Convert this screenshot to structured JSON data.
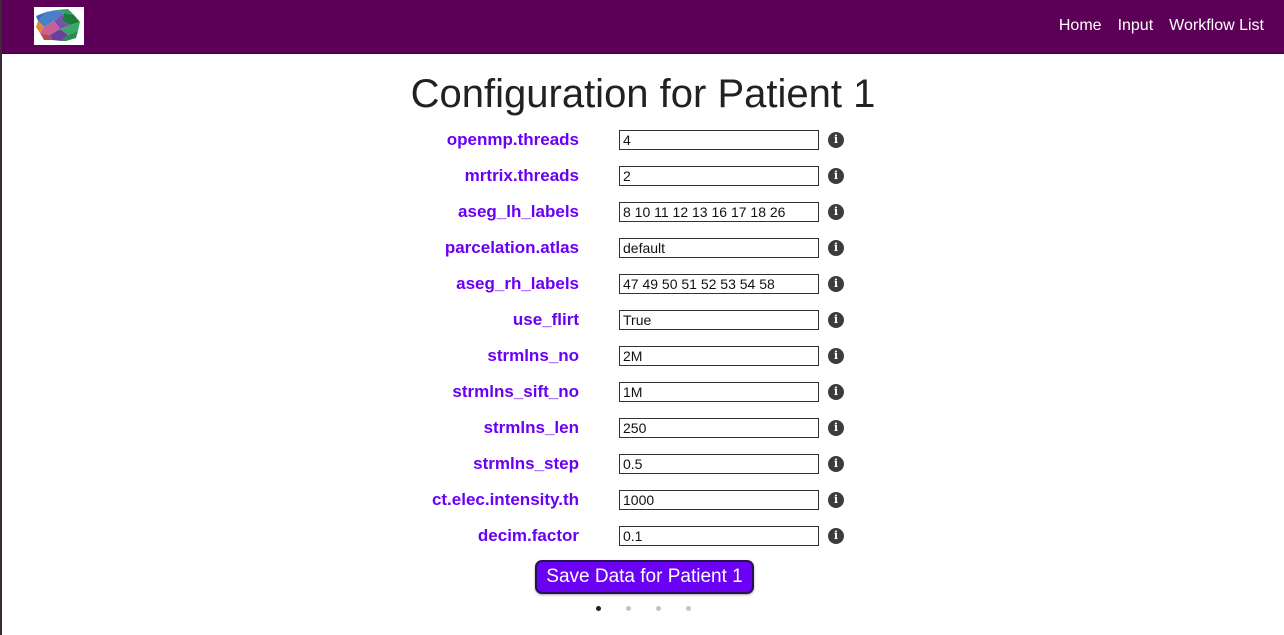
{
  "brand": {
    "logo_icon": "brain-logo-icon"
  },
  "nav": {
    "items": [
      {
        "label": "Home"
      },
      {
        "label": "Input"
      },
      {
        "label": "Workflow List"
      }
    ]
  },
  "page": {
    "title": "Configuration for Patient 1"
  },
  "config": {
    "rows": [
      {
        "label": "openmp.threads",
        "value": "4"
      },
      {
        "label": "mrtrix.threads",
        "value": "2"
      },
      {
        "label": "aseg_lh_labels",
        "value": "8 10 11 12 13 16 17 18 26"
      },
      {
        "label": "parcelation.atlas",
        "value": "default"
      },
      {
        "label": "aseg_rh_labels",
        "value": "47 49 50 51 52 53 54 58"
      },
      {
        "label": "use_flirt",
        "value": "True"
      },
      {
        "label": "strmlns_no",
        "value": "2M"
      },
      {
        "label": "strmlns_sift_no",
        "value": "1M"
      },
      {
        "label": "strmlns_len",
        "value": "250"
      },
      {
        "label": "strmlns_step",
        "value": "0.5"
      },
      {
        "label": "ct.elec.intensity.th",
        "value": "1000"
      },
      {
        "label": "decim.factor",
        "value": "0.1"
      }
    ],
    "info_icon": "info-circle-icon"
  },
  "actions": {
    "save_label": "Save Data for Patient 1"
  },
  "pagination": {
    "count": 4,
    "active": 1
  },
  "colors": {
    "navbar": "#5c0057",
    "label": "#6a00f4",
    "button": "#6a00f4"
  }
}
